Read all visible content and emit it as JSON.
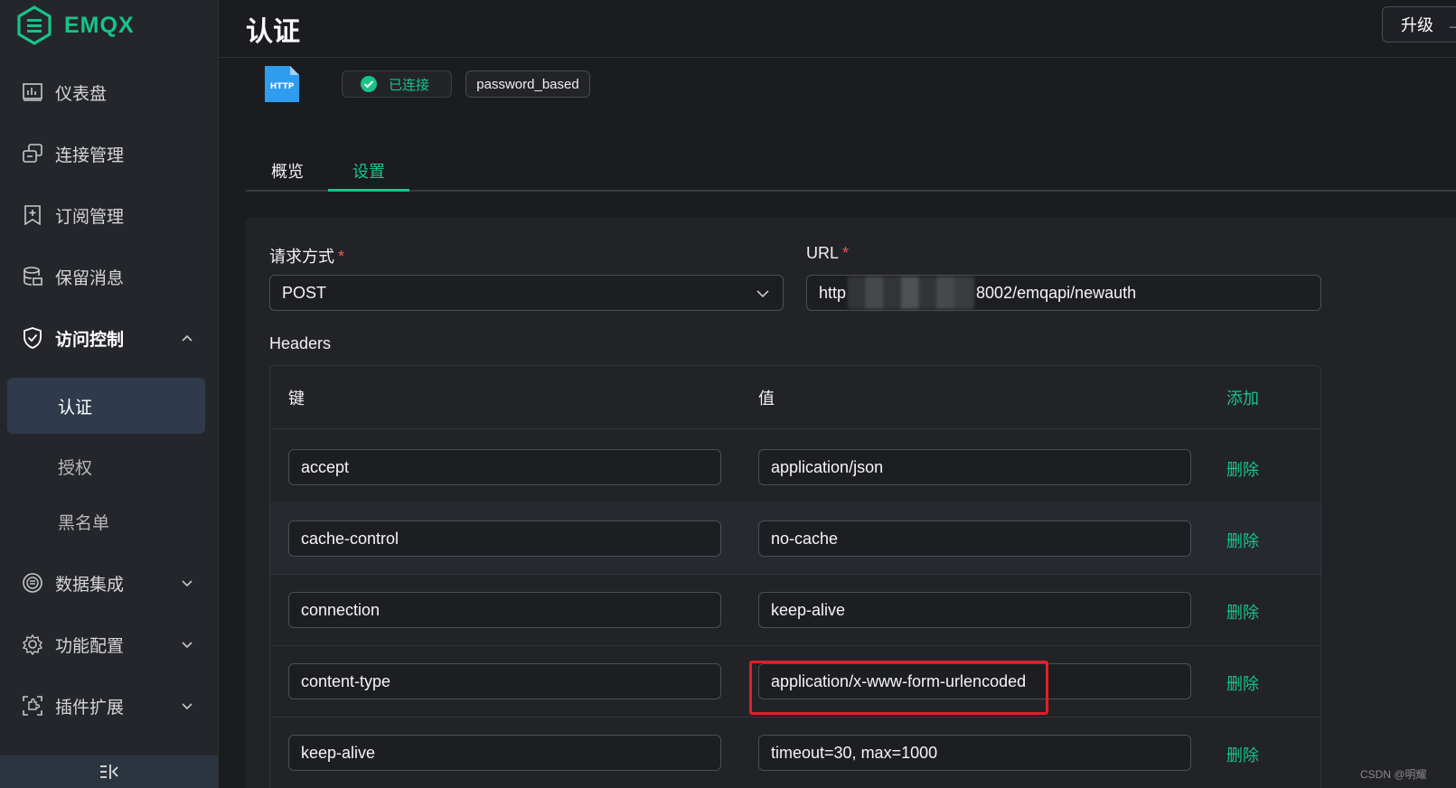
{
  "brand": {
    "name": "EMQX",
    "color": "#17c487"
  },
  "sidebar": {
    "items": [
      {
        "label": "仪表盘",
        "icon": "dashboard-icon"
      },
      {
        "label": "连接管理",
        "icon": "connections-icon"
      },
      {
        "label": "订阅管理",
        "icon": "subscriptions-icon"
      },
      {
        "label": "保留消息",
        "icon": "retained-messages-icon"
      },
      {
        "label": "访问控制",
        "icon": "shield-icon",
        "expanded": true
      },
      {
        "label": "数据集成",
        "icon": "data-integration-icon"
      },
      {
        "label": "功能配置",
        "icon": "settings-gear-icon"
      },
      {
        "label": "插件扩展",
        "icon": "plugin-icon"
      }
    ],
    "sub_items": [
      {
        "label": "认证",
        "active": true
      },
      {
        "label": "授权",
        "active": false
      },
      {
        "label": "黑名单",
        "active": false
      }
    ],
    "collapse_icon": "collapse-sidebar-icon"
  },
  "header": {
    "title": "认证",
    "upgrade_label": "升级",
    "upgrade_icon": "arrow-right-icon"
  },
  "auth": {
    "backend_icon": "HTTP",
    "status": "已连接",
    "mechanism": "password_based"
  },
  "tabs": [
    {
      "label": "概览",
      "active": false
    },
    {
      "label": "设置",
      "active": true
    }
  ],
  "form": {
    "method": {
      "label": "请求方式",
      "required": true,
      "value": "POST"
    },
    "url": {
      "label": "URL",
      "required": true,
      "value_prefix": "http",
      "value_suffix": "8002/emqapi/newauth"
    },
    "headers_title": "Headers",
    "headers_table": {
      "columns": {
        "key": "键",
        "value": "值",
        "add": "添加"
      },
      "delete_label": "删除",
      "rows": [
        {
          "key": "accept",
          "value": "application/json"
        },
        {
          "key": "cache-control",
          "value": "no-cache"
        },
        {
          "key": "connection",
          "value": "keep-alive"
        },
        {
          "key": "content-type",
          "value": "application/x-www-form-urlencoded",
          "highlighted": true
        },
        {
          "key": "keep-alive",
          "value": "timeout=30, max=1000"
        }
      ]
    }
  },
  "watermark": "CSDN @明耀",
  "colors": {
    "accent": "#17c487",
    "required": "#f25757",
    "highlight": "#e21f2a"
  }
}
